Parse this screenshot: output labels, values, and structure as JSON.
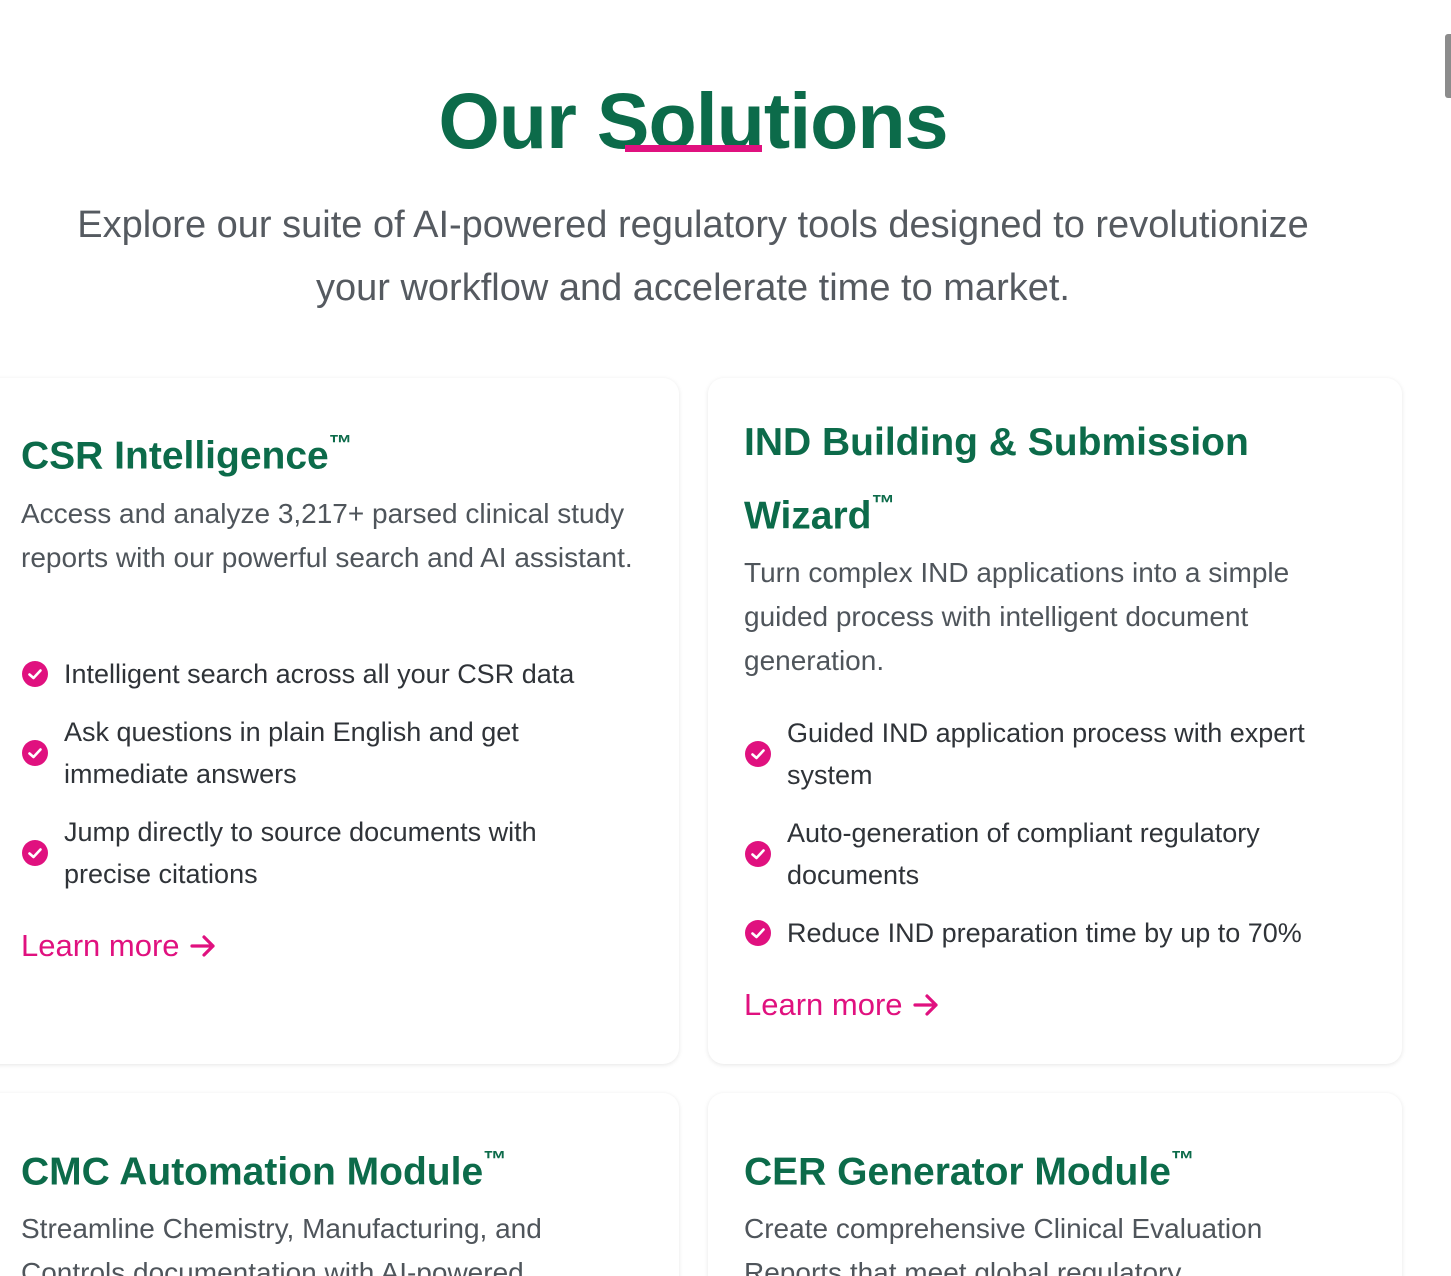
{
  "section": {
    "title": "Our Solutions",
    "intro_line1": "Explore our suite of AI-powered regulatory tools designed to revolutionize",
    "intro_line2": "your workflow and accelerate time to market."
  },
  "cards": [
    {
      "title": "CSR Intelligence",
      "tm": "™",
      "description": "Access and analyze 3,217+ parsed clinical study reports with our powerful search and AI assistant.",
      "features": [
        "Intelligent search across all your CSR data",
        "Ask questions in plain English and get immediate answers",
        "Jump directly to source documents with precise citations"
      ],
      "link": "Learn more"
    },
    {
      "title": "IND Building & Submission Wizard",
      "tm": "™",
      "description": "Turn complex IND applications into a simple guided process with intelligent document generation.",
      "features": [
        "Guided IND application process with expert system",
        "Auto-generation of compliant regulatory documents",
        "Reduce IND preparation time by up to 70%"
      ],
      "link": "Learn more"
    },
    {
      "title": "CMC Automation Module",
      "tm": "™",
      "description": "Streamline Chemistry, Manufacturing, and Controls documentation with AI-powered"
    },
    {
      "title": "CER Generator Module",
      "tm": "™",
      "description": "Create comprehensive Clinical Evaluation Reports that meet global regulatory"
    }
  ],
  "colors": {
    "brand_green": "#0c6b4a",
    "accent_pink": "#e0117f",
    "body_text": "#4f555b"
  },
  "icons": {
    "feature_bullet": "check-circle-icon",
    "link_arrow": "arrow-right-icon"
  }
}
